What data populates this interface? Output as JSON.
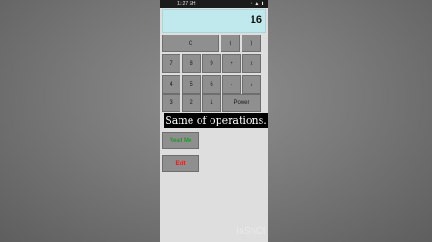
{
  "status_bar": {
    "time": "11:27 SH",
    "icons": "◔ ▲ ▮"
  },
  "display": {
    "value": "16"
  },
  "keypad": {
    "clear": "C",
    "open_paren": "(",
    "close_paren": ")",
    "seven": "7",
    "eight": "8",
    "nine": "9",
    "plus": "+",
    "multiply": "x",
    "four": "4",
    "five": "5",
    "six": "6",
    "minus": "-",
    "divide": "/",
    "three": "3",
    "two": "2",
    "one": "1",
    "power": "Power"
  },
  "caption": "Same of operations.",
  "actions": {
    "read_me": "Read Me",
    "exit": "Exit"
  },
  "watermark": "InShOt"
}
